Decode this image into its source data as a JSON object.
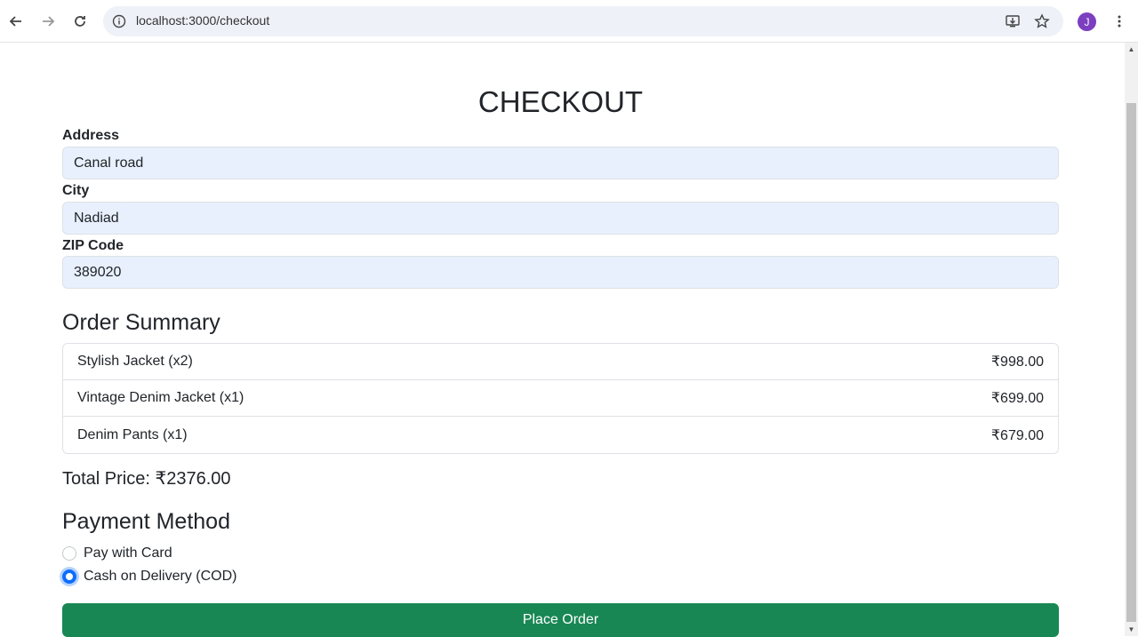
{
  "browser": {
    "url": "localhost:3000/checkout",
    "avatar_initial": "J",
    "accent": "#7b3fbf"
  },
  "checkout": {
    "title": "CHECKOUT",
    "address": {
      "label": "Address",
      "value": "Canal road"
    },
    "city": {
      "label": "City",
      "value": "Nadiad"
    },
    "zip": {
      "label": "ZIP Code",
      "value": "389020"
    }
  },
  "order_summary": {
    "heading": "Order Summary",
    "items": [
      {
        "name": "Stylish Jacket (x2)",
        "price": "₹998.00"
      },
      {
        "name": "Vintage Denim Jacket (x1)",
        "price": "₹699.00"
      },
      {
        "name": "Denim Pants (x1)",
        "price": "₹679.00"
      }
    ],
    "total": "Total Price: ₹2376.00"
  },
  "payment": {
    "heading": "Payment Method",
    "options": [
      {
        "label": "Pay with Card",
        "checked": false
      },
      {
        "label": "Cash on Delivery (COD)",
        "checked": true
      }
    ]
  },
  "actions": {
    "place_order": "Place Order",
    "button_color": "#198754"
  }
}
